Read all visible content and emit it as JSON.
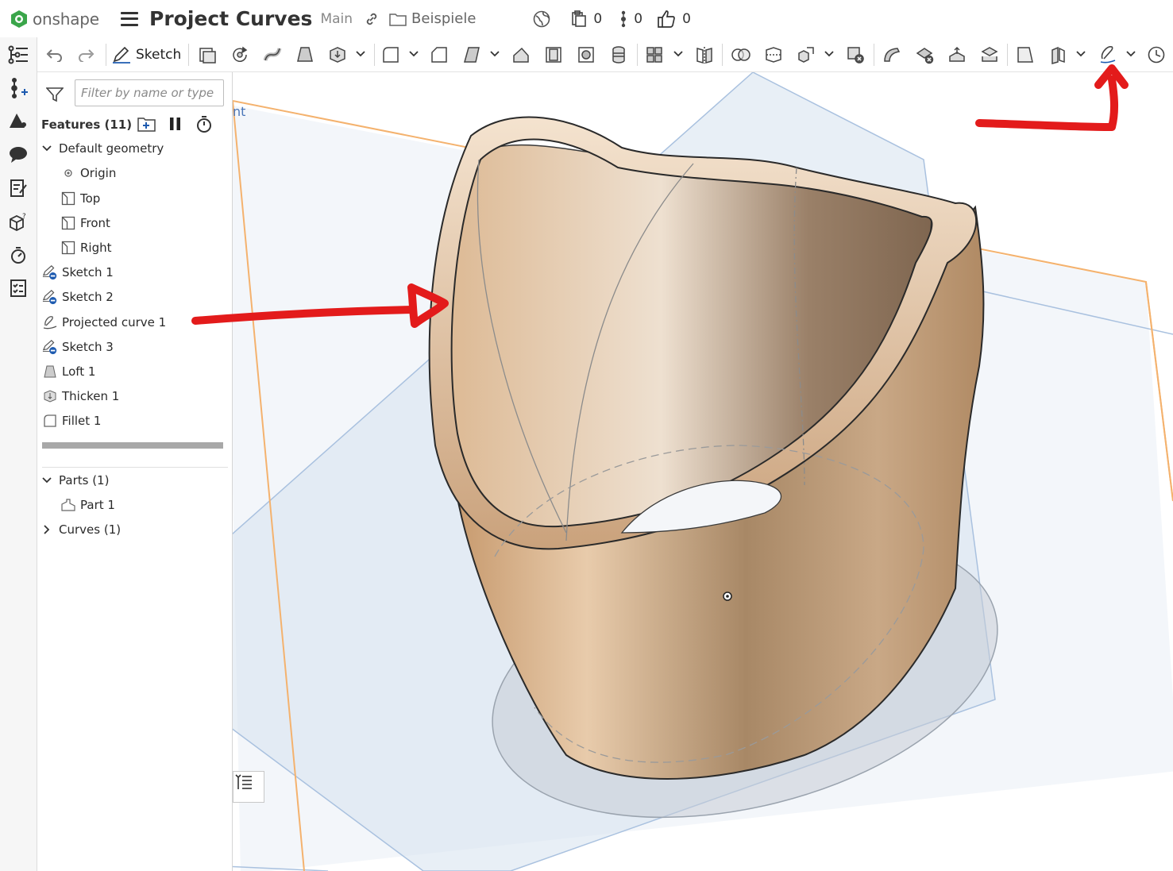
{
  "app": {
    "brand": "onshape"
  },
  "document": {
    "title": "Project Curves",
    "branch": "Main",
    "folder": "Beispiele"
  },
  "top_counters": [
    {
      "icon": "clipboard-icon",
      "value": "0"
    },
    {
      "icon": "version-icon",
      "value": "0"
    },
    {
      "icon": "thumbs-up-icon",
      "value": "0"
    }
  ],
  "toolbar": {
    "sketch_label": "Sketch"
  },
  "panel": {
    "filter_placeholder": "Filter by name or type",
    "features_title": "Features (11)",
    "default_geometry": "Default geometry",
    "geometry_items": [
      "Origin",
      "Top",
      "Front",
      "Right"
    ],
    "features": [
      "Sketch 1",
      "Sketch 2",
      "Projected curve 1",
      "Sketch 3",
      "Loft 1",
      "Thicken 1",
      "Fillet 1"
    ],
    "parts_title": "Parts (1)",
    "parts": [
      "Part 1"
    ],
    "curves_title": "Curves (1)"
  },
  "viewport": {
    "plane_label_fragment": "nt"
  },
  "colors": {
    "accent": "#1e5bb0",
    "annotation": "#e31b1b",
    "part": "#c9a27a",
    "plane": "#cfd9e6"
  }
}
